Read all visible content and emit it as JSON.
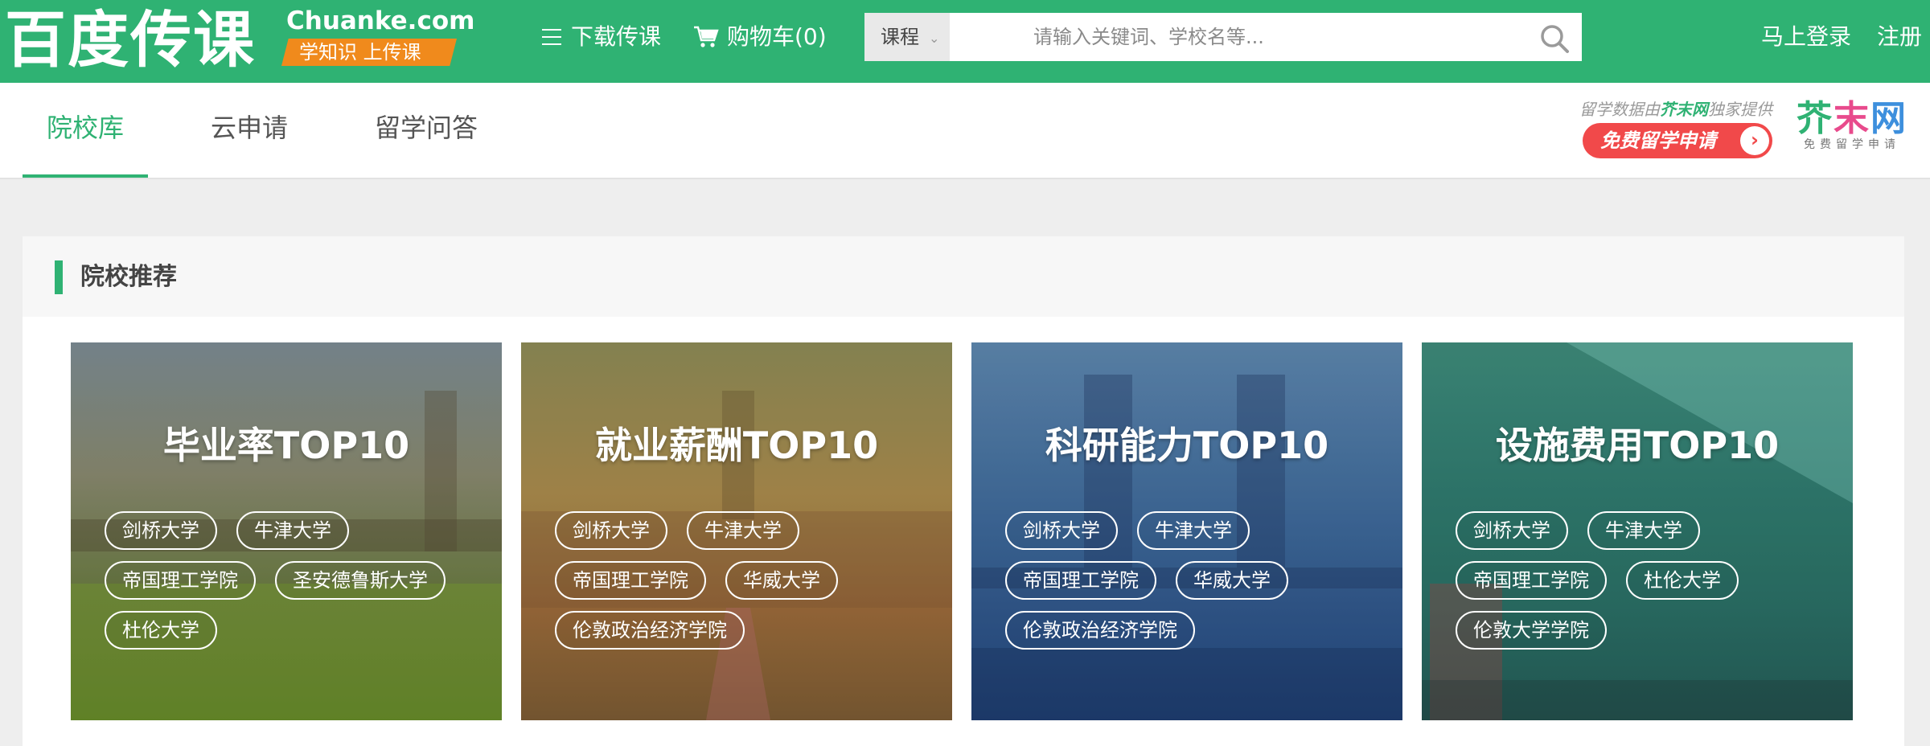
{
  "header": {
    "logo_cn": "百度传课",
    "logo_en": "Chuanke.com",
    "slogan": "学知识 上传课",
    "nav_download": "下载传课",
    "nav_cart": "购物车(0)",
    "search": {
      "category": "课程",
      "placeholder": "请输入关键词、学校名等..."
    },
    "login": "马上登录",
    "register": "注册"
  },
  "subnav": {
    "tabs": [
      {
        "label": "院校库",
        "active": true
      },
      {
        "label": "云申请",
        "active": false
      },
      {
        "label": "留学问答",
        "active": false
      }
    ],
    "promo": {
      "text_prefix": "留学数据由",
      "brand": "芥末网",
      "text_suffix": "独家提供",
      "button": "免费留学申请",
      "logo_main": [
        "芥",
        "末",
        "网"
      ],
      "logo_sub": "免费留学申请"
    }
  },
  "recommend": {
    "title": "院校推荐",
    "cards": [
      {
        "title": "毕业率TOP10",
        "tags": [
          "剑桥大学",
          "牛津大学",
          "帝国理工学院",
          "圣安德鲁斯大学",
          "杜伦大学"
        ]
      },
      {
        "title": "就业薪酬TOP10",
        "tags": [
          "剑桥大学",
          "牛津大学",
          "帝国理工学院",
          "华威大学",
          "伦敦政治经济学院"
        ]
      },
      {
        "title": "科研能力TOP10",
        "tags": [
          "剑桥大学",
          "牛津大学",
          "帝国理工学院",
          "华威大学",
          "伦敦政治经济学院"
        ]
      },
      {
        "title": "设施费用TOP10",
        "tags": [
          "剑桥大学",
          "牛津大学",
          "帝国理工学院",
          "杜伦大学",
          "伦敦大学学院"
        ]
      }
    ]
  },
  "colors": {
    "brand_green": "#2fb273",
    "slogan_orange": "#f08a1c",
    "promo_red": "#f1494a"
  },
  "icons": {
    "menu": "list-icon",
    "cart": "cart-icon",
    "search": "magnifier-icon",
    "promo_arrow": "chevron-right-icon"
  }
}
